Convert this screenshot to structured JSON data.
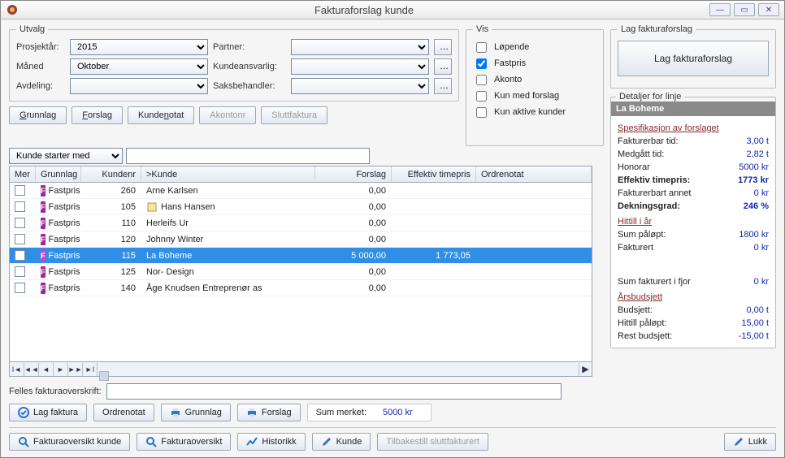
{
  "window": {
    "title": "Fakturaforslag kunde"
  },
  "utvalg": {
    "legend": "Utvalg",
    "prosjektar_label": "Prosjektår:",
    "prosjektar_value": "2015",
    "maaned_label": "Måned",
    "maaned_value": "Oktober",
    "avdeling_label": "Avdeling:",
    "avdeling_value": "",
    "partner_label": "Partner:",
    "partner_value": "",
    "kundeansv_label": "Kundeansvarlig:",
    "kundeansv_value": "",
    "saksbeh_label": "Saksbehandler:",
    "saksbeh_value": ""
  },
  "tabs": {
    "grunnlag": "Grunnlag",
    "forslag": "Forslag",
    "kundenotat": "Kundenotat",
    "akontonr": "Akontonr",
    "sluttfaktura": "Sluttfaktura"
  },
  "vis": {
    "legend": "Vis",
    "lopende": "Løpende",
    "fastpris": "Fastpris",
    "akonto": "Akonto",
    "kun_med_forslag": "Kun med forslag",
    "kun_aktive": "Kun aktive kunder",
    "checked": {
      "lopende": false,
      "fastpris": true,
      "akonto": false,
      "kun_med_forslag": false,
      "kun_aktive": false
    }
  },
  "lag": {
    "legend": "Lag fakturaforslag",
    "button": "Lag fakturaforslag"
  },
  "search": {
    "mode": "Kunde starter med",
    "value": ""
  },
  "grid": {
    "headers": {
      "mer": "Mer",
      "grunnlag": "Grunnlag",
      "kundenr": "Kundenr",
      "kunde": ">Kunde",
      "forslag": "Forslag",
      "eff": "Effektiv timepris",
      "ordrenotat": "Ordrenotat"
    },
    "rows": [
      {
        "grunnlag": "Fastpris",
        "kundenr": "260",
        "kunde": "Arne Karlsen",
        "forslag": "0,00",
        "eff": "",
        "notat": false
      },
      {
        "grunnlag": "Fastpris",
        "kundenr": "105",
        "kunde": "Hans Hansen",
        "forslag": "0,00",
        "eff": "",
        "notat": true
      },
      {
        "grunnlag": "Fastpris",
        "kundenr": "110",
        "kunde": "Herleifs Ur",
        "forslag": "0,00",
        "eff": "",
        "notat": false
      },
      {
        "grunnlag": "Fastpris",
        "kundenr": "120",
        "kunde": "Johnny Winter",
        "forslag": "0,00",
        "eff": "",
        "notat": false
      },
      {
        "grunnlag": "Fastpris",
        "kundenr": "115",
        "kunde": "La Boheme",
        "forslag": "5 000,00",
        "eff": "1 773,05",
        "notat": false,
        "selected": true
      },
      {
        "grunnlag": "Fastpris",
        "kundenr": "125",
        "kunde": "Nor- Design",
        "forslag": "0,00",
        "eff": "",
        "notat": false
      },
      {
        "grunnlag": "Fastpris",
        "kundenr": "140",
        "kunde": "Åge Knudsen Entreprenør as",
        "forslag": "0,00",
        "eff": "",
        "notat": false
      }
    ]
  },
  "detail": {
    "legend": "Detaljer for linje",
    "title": "La Boheme",
    "sec1": "Spesifikasjon av forslaget",
    "rows1": [
      {
        "k": "Fakturerbar tid:",
        "v": "3,00 t"
      },
      {
        "k": "Medgått tid:",
        "v": "2,82 t"
      },
      {
        "k": "Honorar",
        "v": "5000 kr"
      },
      {
        "k": "Effektiv timepris:",
        "v": "1773 kr",
        "bold": true
      },
      {
        "k": "Fakturerbart annet",
        "v": "0 kr"
      },
      {
        "k": "Dekningsgrad:",
        "v": "246 %",
        "bold": true
      }
    ],
    "sec2": "Hittill i år",
    "rows2": [
      {
        "k": "Sum påløpt:",
        "v": "1800 kr"
      },
      {
        "k": "Fakturert",
        "v": "0 kr"
      }
    ],
    "sumfjor": {
      "k": "Sum fakturert i fjor",
      "v": "0 kr"
    },
    "sec3": "Årsbudsjett",
    "rows3": [
      {
        "k": "Budsjett:",
        "v": "0,00 t"
      },
      {
        "k": "Hittill påløpt:",
        "v": "15,00 t"
      },
      {
        "k": "Rest budsjett:",
        "v": "-15,00 t"
      }
    ]
  },
  "lower": {
    "felles_label": "Felles fakturaoverskrift:",
    "felles_value": "",
    "lagfaktura": "Lag faktura",
    "ordrenotat": "Ordrenotat",
    "grunnlag": "Grunnlag",
    "forslag": "Forslag",
    "summerket_label": "Sum merket:",
    "summerket_value": "5000 kr"
  },
  "footer": {
    "fakturaoversikt_kunde": "Fakturaoversikt kunde",
    "fakturaoversikt": "Fakturaoversikt",
    "historikk": "Historikk",
    "kunde": "Kunde",
    "tilbakestill": "Tilbakestill sluttfakturert",
    "lukk": "Lukk"
  }
}
